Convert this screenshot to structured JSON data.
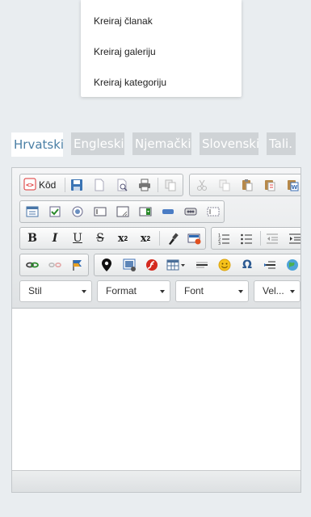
{
  "dropdown_menu": {
    "items": [
      "Kreiraj članak",
      "Kreiraj galeriju",
      "Kreiraj kategoriju"
    ]
  },
  "language_tabs": {
    "active": "Hrvatski",
    "tabs": [
      "Hrvatski",
      "Engleski",
      "Njemački",
      "Slovenski",
      "Tali."
    ]
  },
  "editor": {
    "source_button_label": "Kôd",
    "bold_label": "B",
    "italic_label": "I",
    "underline_label": "U",
    "strike_label": "S",
    "subscript_label": "x",
    "superscript_label": "x",
    "omega_label": "Ω",
    "combos": {
      "style": "Stil",
      "format": "Format",
      "font": "Font",
      "size": "Vel..."
    }
  },
  "colors": {
    "active_tab_text": "#4a7fa5",
    "inactive_tab_bg": "#cfd3d6",
    "page_bg": "#e9edf0"
  }
}
